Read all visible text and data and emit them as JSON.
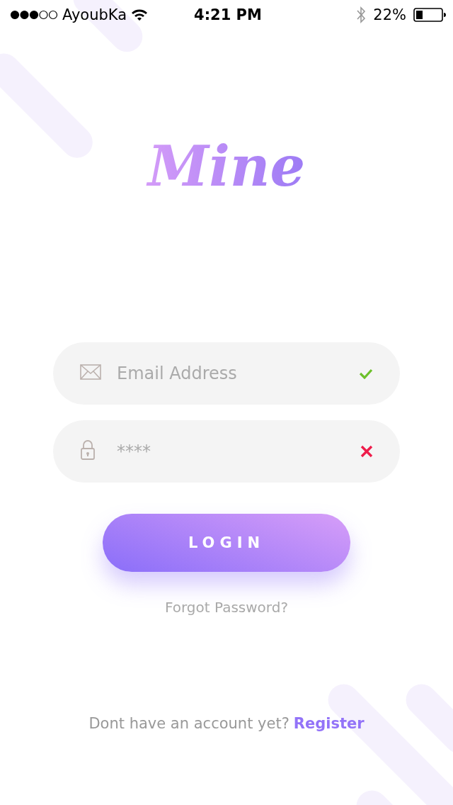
{
  "status_bar": {
    "carrier": "AyoubKa",
    "time": "4:21 PM",
    "battery": "22%"
  },
  "logo": "Mine",
  "fields": [
    {
      "kind": "email",
      "placeholder": "Email Address",
      "valid": true
    },
    {
      "kind": "password",
      "placeholder": "****",
      "valid": false
    }
  ],
  "login_button": "LOGIN",
  "forgot_link": "Forgot Password?",
  "footer": {
    "text": "Dont have an account yet?",
    "link": "Register"
  }
}
